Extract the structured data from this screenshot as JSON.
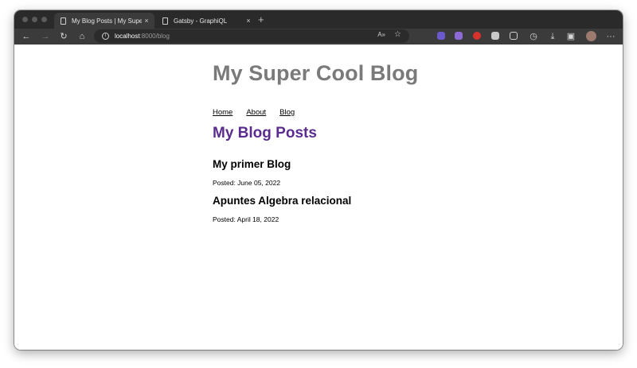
{
  "browser": {
    "tabs": [
      {
        "title": "My Blog Posts | My Super Coo",
        "close": "×"
      },
      {
        "title": "Gatsby - GraphiQL",
        "close": "×"
      }
    ],
    "new_tab": "+",
    "address": {
      "host": "localhost",
      "path": ":8000/blog"
    },
    "toolbar_icons": [
      "back-icon",
      "forward-icon",
      "refresh-icon",
      "home-icon",
      "read-aloud-icon",
      "add-favorite-icon",
      "extension-icons",
      "history-icon",
      "downloads-icon",
      "screenshot-icon",
      "profile-avatar",
      "more-icon"
    ]
  },
  "page": {
    "site_title": "My Super Cool Blog",
    "nav": [
      "Home",
      "About",
      "Blog"
    ],
    "heading": "My Blog Posts",
    "posts": [
      {
        "title": "My primer Blog",
        "date": "Posted: June 05, 2022"
      },
      {
        "title": "Apuntes Algebra relacional",
        "date": "Posted: April 18, 2022"
      }
    ]
  },
  "colors": {
    "heading": "#5b2c8f",
    "site_title": "#7a7a7a",
    "chrome_dark": "#2a2a2a"
  }
}
